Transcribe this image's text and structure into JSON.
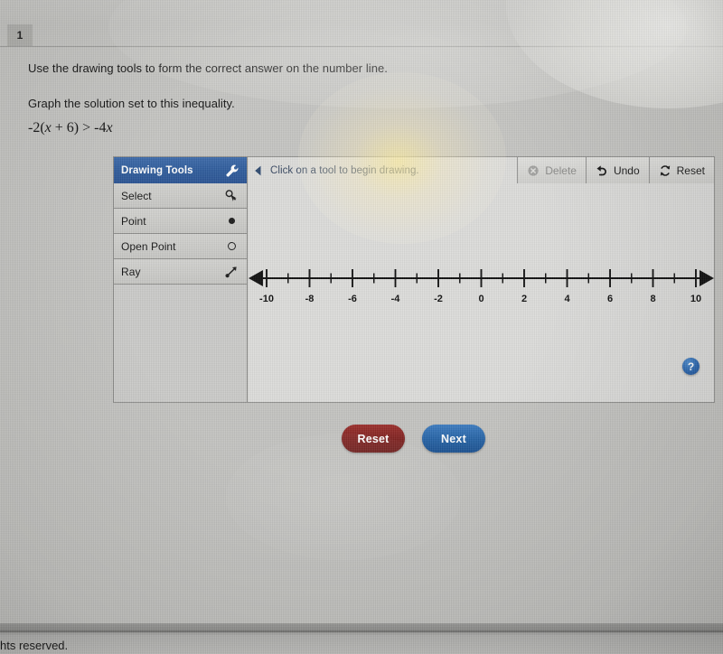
{
  "question": {
    "number": "1",
    "instruction": "Use the drawing tools to form the correct answer on the number line.",
    "prompt": "Graph the solution set to this inequality.",
    "expression": {
      "full": "-2(x + 6) > -4x",
      "lhs_prefix": "-2(",
      "lhs_var": "x",
      "lhs_mid": " + 6) ",
      "relation": ">",
      "rhs_prefix": " -4",
      "rhs_var": "x"
    }
  },
  "drawing_widget": {
    "panel": {
      "header_label": "Drawing Tools",
      "header_icon": "wrench-icon",
      "tools": [
        {
          "label": "Select",
          "icon": "cursor-select-icon"
        },
        {
          "label": "Point",
          "icon": "filled-point-icon"
        },
        {
          "label": "Open Point",
          "icon": "open-point-icon"
        },
        {
          "label": "Ray",
          "icon": "ray-arrow-icon"
        }
      ]
    },
    "canvas": {
      "collapse_icon": "collapse-left-arrow-icon",
      "hint_text": "Click on a tool to begin drawing.",
      "help_label": "?",
      "help_icon": "help-question-icon"
    },
    "toolbar": [
      {
        "label": "Delete",
        "icon": "circle-x-icon",
        "disabled": true
      },
      {
        "label": "Undo",
        "icon": "undo-arrow-icon",
        "disabled": false
      },
      {
        "label": "Reset",
        "icon": "refresh-circular-arrows-icon",
        "disabled": false
      }
    ]
  },
  "number_line": {
    "min": -10,
    "max": 10,
    "major_step": 2,
    "minor_step": 1,
    "labels": [
      "-10",
      "-8",
      "-6",
      "-4",
      "-2",
      "0",
      "2",
      "4",
      "6",
      "8",
      "10"
    ],
    "left_arrow": true,
    "right_arrow": true,
    "plotted_marks": []
  },
  "footer_buttons": {
    "reset_label": "Reset",
    "next_label": "Next"
  },
  "page_footer": {
    "text": "hts reserved."
  },
  "colors": {
    "panel_header_blue": "#2f5c9c",
    "reset_red": "#7f2220",
    "next_blue": "#2563a6",
    "help_blue": "#2a65ae",
    "hint_text": "#3a4a63",
    "screen_bg": "#c4c4c1"
  }
}
